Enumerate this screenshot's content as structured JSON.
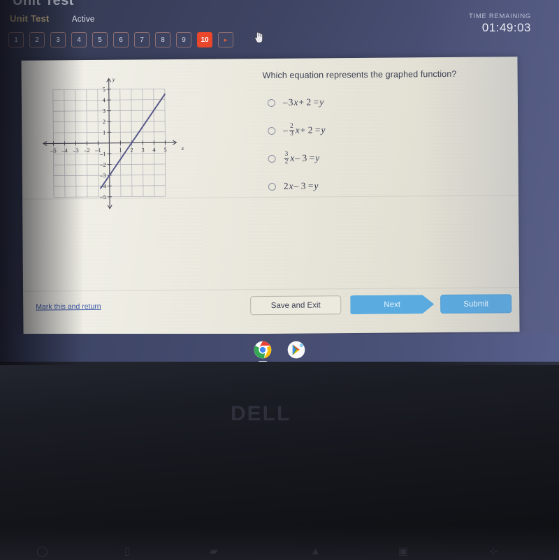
{
  "window": {
    "cut_off_title": "Unit Test"
  },
  "header": {
    "test_tab_label": "Unit Test",
    "status_label": "Active",
    "timer_label": "TIME REMAINING",
    "timer_value": "01:49:03",
    "accent_current": "#e8472b",
    "accent_button": "#5aabe0"
  },
  "question_nav": {
    "numbers": [
      "1",
      "2",
      "3",
      "4",
      "5",
      "6",
      "7",
      "8",
      "9",
      "10"
    ],
    "current": "10",
    "next_arrow": "▸",
    "cursor_icon": "hand-pointer-icon"
  },
  "question": {
    "prompt": "Which equation represents the graphed function?",
    "options": [
      {
        "id": "a",
        "plain": "–3x + 2 = y",
        "parts": [
          {
            "t": "text",
            "v": "–"
          },
          {
            "t": "text",
            "v": "3"
          },
          {
            "t": "ital",
            "v": "x"
          },
          {
            "t": "text",
            "v": " + 2 = "
          },
          {
            "t": "ital",
            "v": "y"
          }
        ]
      },
      {
        "id": "b",
        "plain": "–(2/3)x + 2 = y",
        "parts": [
          {
            "t": "text",
            "v": "–"
          },
          {
            "t": "frac",
            "num": "2",
            "den": "3"
          },
          {
            "t": "ital",
            "v": "x"
          },
          {
            "t": "text",
            "v": " + 2 = "
          },
          {
            "t": "ital",
            "v": "y"
          }
        ]
      },
      {
        "id": "c",
        "plain": "(3/2)x – 3 = y",
        "parts": [
          {
            "t": "frac",
            "num": "3",
            "den": "2"
          },
          {
            "t": "ital",
            "v": "x"
          },
          {
            "t": "text",
            "v": " – 3 = "
          },
          {
            "t": "ital",
            "v": "y"
          }
        ]
      },
      {
        "id": "d",
        "plain": "2x – 3 = y",
        "parts": [
          {
            "t": "text",
            "v": "2"
          },
          {
            "t": "ital",
            "v": "x"
          },
          {
            "t": "text",
            "v": " – 3 = "
          },
          {
            "t": "ital",
            "v": "y"
          }
        ]
      }
    ],
    "selected": null
  },
  "chart_data": {
    "type": "line",
    "title": "",
    "xlabel": "x",
    "ylabel": "y",
    "xlim": [
      -5.5,
      5.5
    ],
    "ylim": [
      -5.5,
      5.5
    ],
    "xticks": [
      -5,
      -4,
      -3,
      -2,
      -1,
      1,
      2,
      3,
      4,
      5
    ],
    "yticks": [
      5,
      4,
      3,
      2,
      1,
      -1,
      -2,
      -3,
      -4,
      -5
    ],
    "grid": true,
    "grid_extent": {
      "x": [
        -5,
        5
      ],
      "y": [
        -5,
        5
      ]
    },
    "legend": "none",
    "series": [
      {
        "name": "graphed function",
        "equation": "y = (3/2)x - 3",
        "slope": 1.5,
        "intercept": -3,
        "color": "#5a5a8c",
        "points": [
          [
            -0.8,
            -4.2
          ],
          [
            0,
            -3
          ],
          [
            2,
            0
          ],
          [
            4,
            3
          ],
          [
            5,
            4.5
          ]
        ],
        "x_intercept": 2,
        "y_intercept": -3
      }
    ]
  },
  "footer": {
    "mark_link": "Mark this and return",
    "save_label": "Save and Exit",
    "next_label": "Next",
    "submit_label": "Submit"
  },
  "taskbar": {
    "icons": [
      {
        "name": "chrome-icon",
        "label": "Google Chrome"
      },
      {
        "name": "play-store-icon",
        "label": "Google Play Store"
      }
    ]
  },
  "monitor": {
    "brand": "DELL"
  }
}
